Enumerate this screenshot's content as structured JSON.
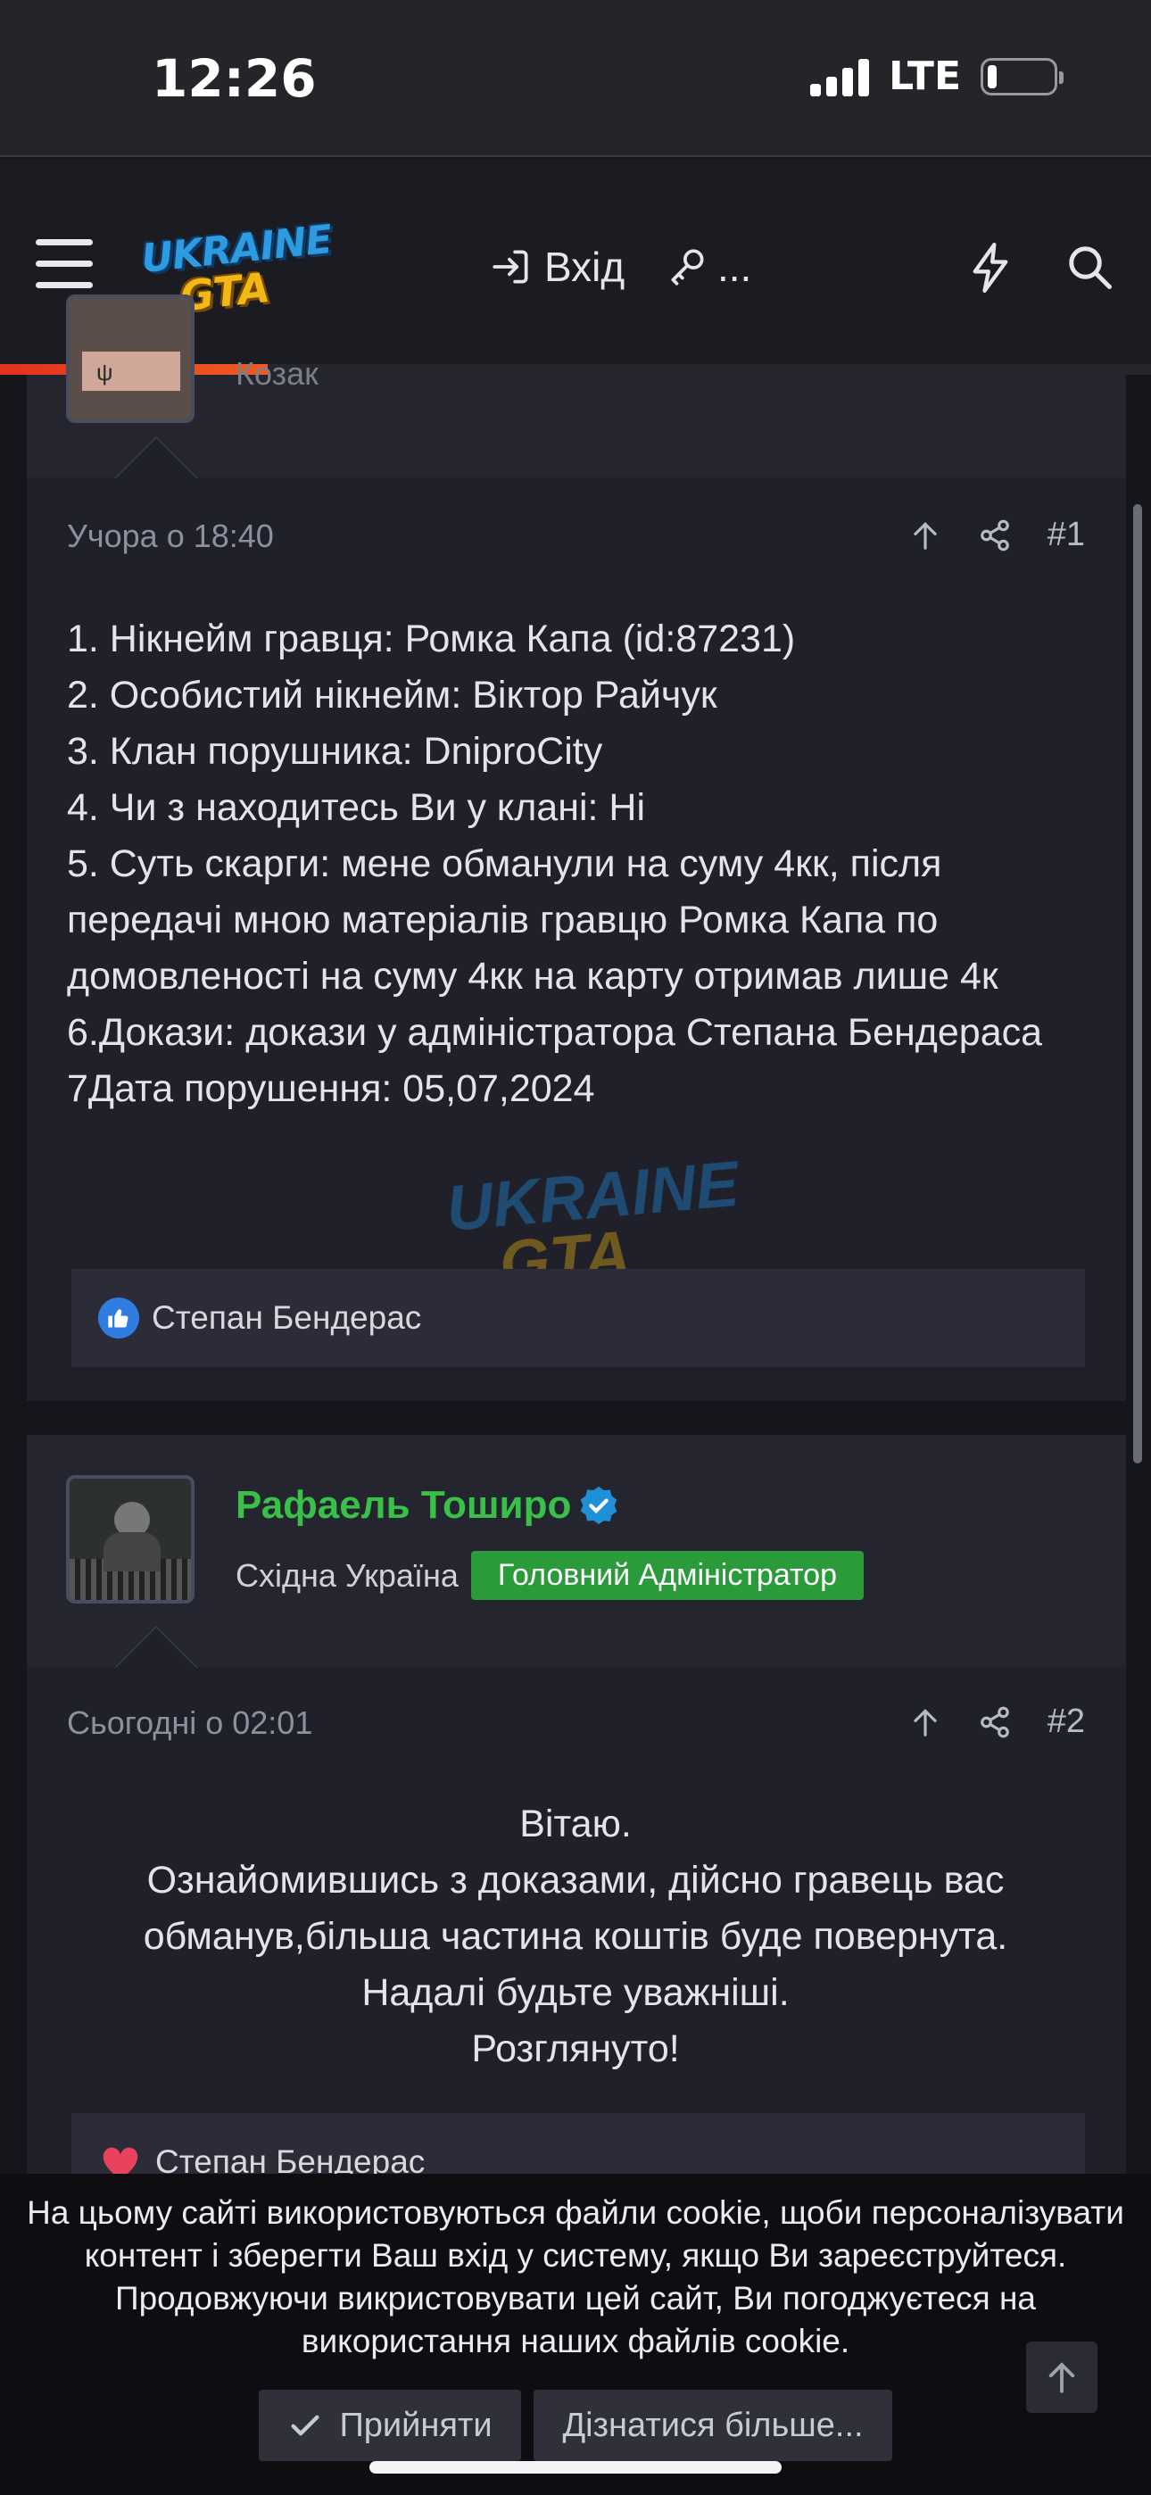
{
  "status_bar": {
    "time": "12:26",
    "network": "LTE"
  },
  "nav": {
    "logo_line1": "UKRAINE",
    "logo_line2": "GTA",
    "login_label": "Вхід",
    "register_label": "...",
    "accent": "#e2331f"
  },
  "posts": [
    {
      "author_rank": "Козак",
      "date": "Учора о 18:40",
      "number": "#1",
      "lines": [
        "1. Нікнейм гравця: Ромка Капа (id:87231)",
        "2. Особистий нікнейм: Віктор Райчук",
        "3. Клан порушника: DniproCity",
        "4. Чи з находитесь Ви у клані: Ні",
        "5. Суть скарги: мене обманули на суму 4кк, після передачі мною матеріалів гравцю Ромка Капа по домовленості на суму 4кк на карту отримав лише 4к",
        "6.Докази: докази у адміністратора Степана Бендераса",
        "7Дата порушення: 05,07,2024"
      ],
      "reaction_user": "Степан Бендерас",
      "reaction_type": "like-icon"
    },
    {
      "author": "Рафаель Тоширо",
      "location": "Східна Україна",
      "role": "Головний Адміністратор",
      "date": "Сьогодні о 02:01",
      "number": "#2",
      "lines": [
        "Вітаю.",
        "Ознайомившись з доказами, дійсно гравець вас обманув,більша частина коштів буде повернута.",
        "Надалі будьте уважніші.",
        "Розглянуто!"
      ],
      "reaction_user": "Степан Бендерас",
      "reaction_type": "love-icon"
    }
  ],
  "cookie": {
    "text": "На цьому сайті використовуються файли cookie, щоби персоналізувати контент і зберегти Ваш вхід у систему, якщо Ви зареєструйтеся. Продовжуючи викристовувати цей сайт, Ви погоджуєтеся на використання наших файлів cookie.",
    "accept_label": "Прийняти",
    "learn_more_label": "Дізнатися більше..."
  },
  "colors": {
    "username_green": "#38c048",
    "role_badge": "#2a9a3a",
    "verified_blue": "#1f8fd8",
    "like_blue": "#2f7de1"
  }
}
